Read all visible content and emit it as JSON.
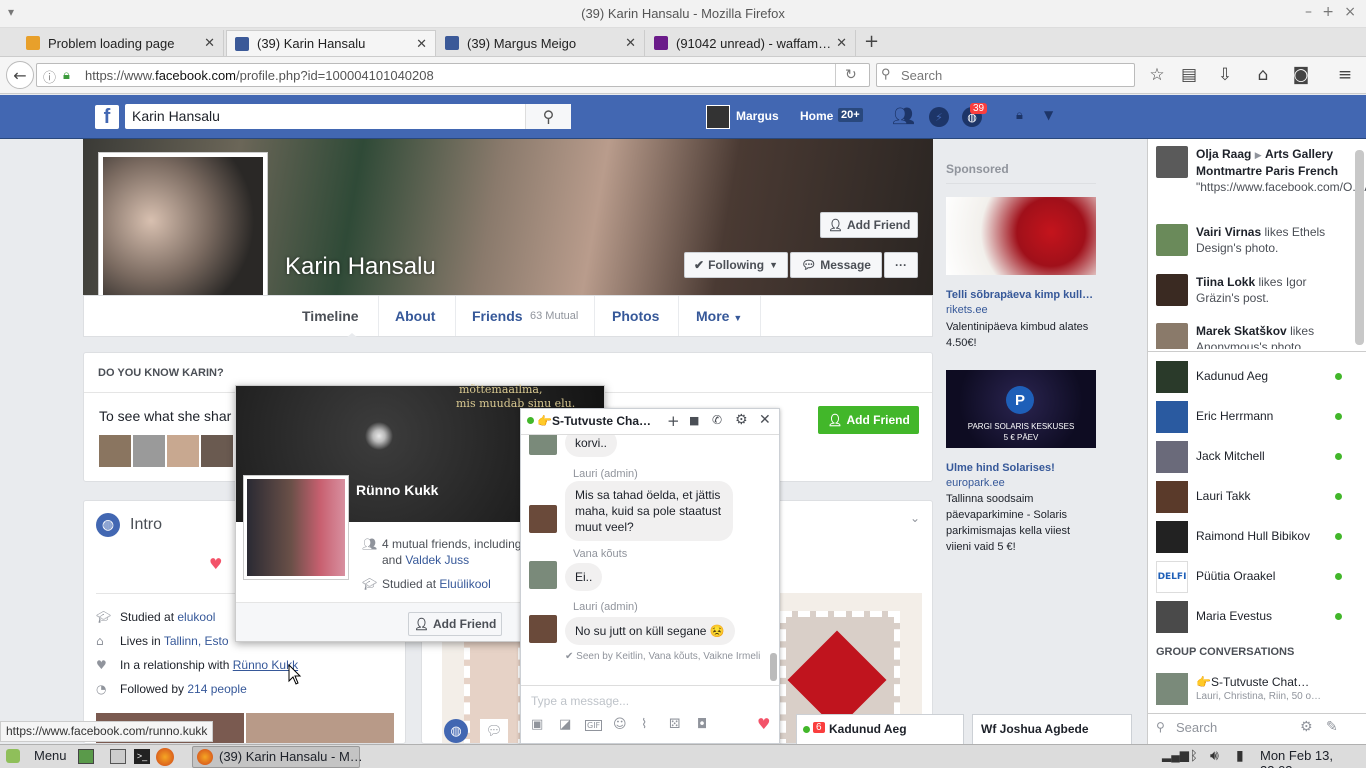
{
  "window": {
    "title": "(39) Karin Hansalu - Mozilla Firefox"
  },
  "tabs": [
    {
      "label": "Problem loading page",
      "color": "#e8a02b"
    },
    {
      "label": "(39) Karin Hansalu",
      "color": "#3b5998"
    },
    {
      "label": "(39) Margus Meigo",
      "color": "#3b5998"
    },
    {
      "label": "(91042 unread) - waffam…",
      "color": "#6b1b8a"
    }
  ],
  "nav": {
    "url_prefix": "https://www.",
    "url_host": "facebook.com",
    "url_path": "/profile.php?id=100004101040208",
    "search_placeholder": "Search"
  },
  "fb": {
    "search_value": "Karin  Hansalu",
    "user_name": "Margus",
    "home_label": "Home",
    "home_badge": "20+",
    "notif_badge": "39"
  },
  "profile": {
    "name": "Karin Hansalu",
    "add_friend": "Add Friend",
    "following": "Following",
    "message": "Message",
    "tabs": {
      "timeline": "Timeline",
      "about": "About",
      "friends": "Friends",
      "mutual": "63 Mutual",
      "photos": "Photos",
      "more": "More"
    }
  },
  "know": {
    "title": "DO YOU KNOW KARIN?",
    "text": "To see what she shar",
    "add_friend": "Add Friend"
  },
  "intro": {
    "title": "Intro",
    "studied_prefix": "Studied at ",
    "studied_link": "elukool",
    "lives_prefix": "Lives in ",
    "lives_link": "Tallinn, Esto",
    "rel_prefix": "In a relationship with ",
    "rel_link": "Rünno Kukk",
    "followed_prefix": "Followed by ",
    "followed_link": "214 people"
  },
  "hovercard": {
    "name": "Rünno Kukk",
    "cover_text_1": "mõttemaailma,",
    "cover_text_2": "mis muudab sinu elu.",
    "mutual_text": "4 mutual friends, including",
    "mutual_and": "and ",
    "mutual_link": "Valdek Juss",
    "studied_prefix": "Studied at ",
    "studied_link": "Eluülikool",
    "add_friend": "Add Friend"
  },
  "chat": {
    "title": "👉S-Tutvuste Cha…",
    "messages": [
      {
        "sender": "",
        "text": "korvi.."
      },
      {
        "sender": "Lauri (admin)",
        "text": "Mis sa tahad öelda, et jättis maha, kuid sa pole staatust muut veel?"
      },
      {
        "sender": "Vana kõuts",
        "text": "Ei.."
      },
      {
        "sender": "Lauri (admin)",
        "text": "No su jutt on küll segane 😣"
      }
    ],
    "seen": "Seen by Keitlin, Vana kõuts, Vaikne Irmeli",
    "input_placeholder": "Type a message..."
  },
  "sponsored": {
    "title": "Sponsored",
    "ads": [
      {
        "title": "Telli sõbrapäeva kimp kull…",
        "domain": "rikets.ee",
        "desc": "Valentinipäeva kimbud alates 4.50€!"
      },
      {
        "title": "Ulme hind Solarises!",
        "domain": "europark.ee",
        "desc": "Tallinna soodsaim päevaparkimine - Solaris parkimismajas kella viiest viieni vaid 5 €!",
        "banner_1": "PARGI SOLARIS KESKUSES",
        "banner_2": "5 € PÄEV"
      }
    ]
  },
  "ticker": [
    {
      "name": "Olja Raag",
      "target": "Arts Gallery Montmartre Paris French",
      "text": "\"https://www.facebook.com/O.RAAG.ART/\""
    },
    {
      "name": "Vairi Virnas",
      "text": " likes Ethels Design's photo."
    },
    {
      "name": "Tiina Lokk",
      "text": " likes Igor Gräzin's post."
    },
    {
      "name": "Marek Skatškov",
      "text": " likes Anonymous's photo."
    }
  ],
  "contacts": [
    "Kadunud Aeg",
    "Eric Herrmann",
    "Jack Mitchell",
    "Lauri Takk",
    "Raimond Hull Bibikov",
    "Püütia Oraakel",
    "Maria Evestus"
  ],
  "group": {
    "heading": "GROUP CONVERSATIONS",
    "name": "👉S-Tutvuste Chat…",
    "members": "Lauri, Christina, Riin, 50 o…"
  },
  "chat_search_placeholder": "Search",
  "chat_tabs": [
    {
      "badge": "6",
      "name": "Kadunud Aeg"
    },
    {
      "name": "Wf Joshua Agbede"
    }
  ],
  "status_url": "https://www.facebook.com/runno.kukk",
  "taskbar": {
    "menu": "Menu",
    "window": "(39) Karin Hansalu - M…",
    "clock": "Mon Feb 13, 23:03"
  },
  "colors": {
    "fb_blue": "#4267b2",
    "link": "#365899",
    "green": "#42b72a"
  }
}
